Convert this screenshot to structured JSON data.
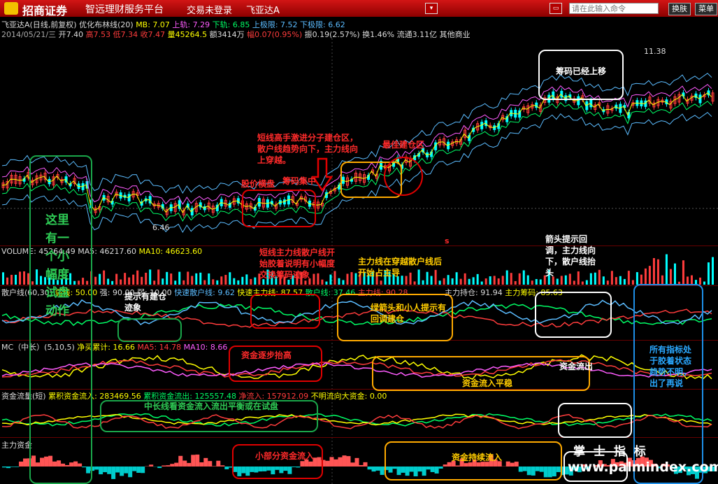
{
  "titlebar": {
    "broker": "招商证券",
    "platform": "智远理财服务平台",
    "trade_status": "交易未登录",
    "stock": "飞亚达A",
    "command_placeholder": "请在此输入命令",
    "switch_label": "换肤",
    "menu_label": "菜单"
  },
  "main_info": {
    "line1_a": "飞亚达A(日线,前复权) 优化布林线(20)",
    "mb": "MB: 7.07",
    "up": "上轨: 7.29",
    "down": "下轨: 6.85",
    "upper_limit": "上极限: 7.52",
    "lower_limit": "下极限: 6.62",
    "line2_date": "2014/05/21/三",
    "open": "开7.40",
    "high": "高7.53",
    "low": "低7.34",
    "close": "收7.47",
    "vol": "量45264.5",
    "amount": "额3414万",
    "change": "幅0.07(0.95%)",
    "amp": "振0.19(2.57%)",
    "turnover": "换1.46%",
    "float": "流通3.11亿",
    "sector": "其他商业"
  },
  "price_labels": {
    "high": "11.38",
    "low": "6.46"
  },
  "volume_info": {
    "vol": "VOLUME: 45264.49",
    "ma5": "MA5: 46217.60",
    "ma10": "MA10: 46623.60"
  },
  "scatter_info": {
    "title": "散户线(60,30)",
    "weak": "弱线: 50.00",
    "strong": "强: 90.00",
    "low": "弱: 10.00",
    "fast_retail": "快速散户线: 9.62",
    "fast_main": "快速主力线: 87.57",
    "retail": "散户线: 37.46",
    "main": "主力线: 90.28",
    "hold": "主力持仓: 91.94",
    "chip": "主力筹码: 85.63"
  },
  "mc_info": {
    "title": "MC（中长）(5,10,5)",
    "net": "净买累计: 16.66",
    "ma5": "MA5: 14.78",
    "ma10": "MA10: 8.66"
  },
  "flow_info": {
    "title": "资金流量(短)",
    "inflow": "累积资金流入: 283469.56",
    "outflow": "累积资金流出: 125557.48",
    "net": "净流入: 157912.09",
    "unknown": "不明流向大资金: 0.00"
  },
  "main_fund_info": {
    "title": "主力资金"
  },
  "annotations": {
    "chips_up": "筹码已经上移",
    "short_line": "短线高手激进分子建仓区，\n散户线趋势向下，主力线向\n上穿越。",
    "best_zone": "最佳建仓区",
    "consolidate": "股价横盘",
    "chip_gather": "筹码集中",
    "small_test": "这里\n有一\n个小\n幅度\n试盘\n动作",
    "short_main": "短线主力线散户线开\n始胶着说明有小幅度\n交换筹码迹象",
    "main_cross": "主力线在穿越散户线后\n开始占主导",
    "arrow_tip": "箭头提示回\n调，主力线向\n下，散户线抬\n头",
    "build_tip": "提示有建仓\n迹象",
    "green_arrow": "绿箭头和小人提示有\n回调建仓",
    "fund_grow": "资金逐步抬高",
    "fund_steady": "资金流入平稳",
    "fund_out": "资金流出",
    "all_indicators": "所有指标处\n于胶着状态\n趋势不明，\n出了再说",
    "long_balance": "中长线看资金流入流出平衡或在试盘",
    "small_flow": "小部分资金流入",
    "sustained": "资金持续流入",
    "watermark_cn": "掌 士 指 标",
    "watermark_url": "www.palmindex.com",
    "marker_s": "s"
  },
  "colors": {
    "up": "#ff3c3c",
    "down": "#00ffff",
    "accent": "#ffff00"
  }
}
